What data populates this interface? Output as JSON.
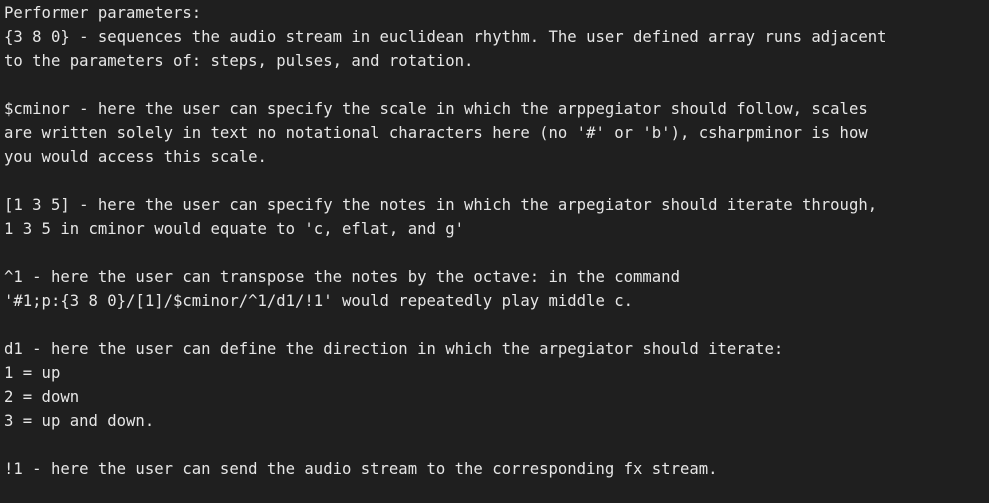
{
  "background": "#1f1f1f",
  "text_color": "#e6e6e6",
  "heading": "Performer parameters:",
  "sections": [
    {
      "id": "rhythm",
      "lines": [
        "{3 8 0} - sequences the audio stream in euclidean rhythm. The user defined array runs adjacent",
        "to the parameters of: steps, pulses, and rotation."
      ]
    },
    {
      "id": "scale",
      "lines": [
        "$cminor - here the user can specify the scale in which the arppegiator should follow, scales",
        "are written solely in text no notational characters here (no '#' or 'b'), csharpminor is how",
        "you would access this scale."
      ]
    },
    {
      "id": "notes",
      "lines": [
        "[1 3 5] - here the user can specify the notes in which the arpegiator should iterate through,",
        "1 3 5 in cminor would equate to 'c, eflat, and g'"
      ]
    },
    {
      "id": "octave",
      "lines": [
        "^1 - here the user can transpose the notes by the octave: in the command",
        "'#1;p:{3 8 0}/[1]/$cminor/^1/d1/!1' would repeatedly play middle c."
      ]
    },
    {
      "id": "direction",
      "lines": [
        "d1 - here the user can define the direction in which the arpegiator should iterate:",
        "1 = up",
        "2 = down",
        "3 = up and down."
      ]
    },
    {
      "id": "fx",
      "lines": [
        "!1 - here the user can send the audio stream to the corresponding fx stream."
      ]
    }
  ]
}
